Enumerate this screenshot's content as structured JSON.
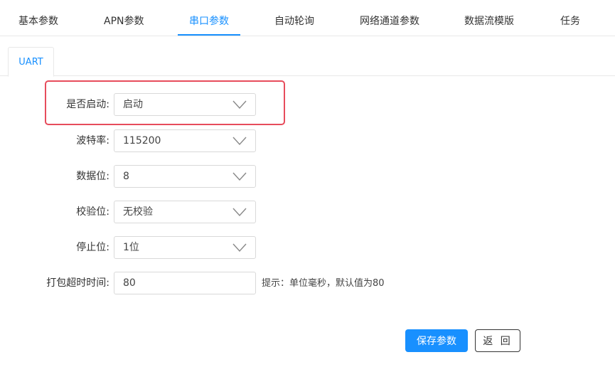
{
  "top_tabs": [
    {
      "label": "基本参数",
      "active": false
    },
    {
      "label": "APN参数",
      "active": false
    },
    {
      "label": "串口参数",
      "active": true
    },
    {
      "label": "自动轮询",
      "active": false
    },
    {
      "label": "网络通道参数",
      "active": false
    },
    {
      "label": "数据流模版",
      "active": false
    },
    {
      "label": "任务",
      "active": false
    }
  ],
  "sub_tabs": [
    {
      "label": "UART",
      "active": true
    }
  ],
  "form": {
    "enabled": {
      "label": "是否启动:",
      "value": "启动"
    },
    "baud_rate": {
      "label": "波特率:",
      "value": "115200"
    },
    "data_bits": {
      "label": "数据位:",
      "value": "8"
    },
    "parity": {
      "label": "校验位:",
      "value": "无校验"
    },
    "stop_bits": {
      "label": "停止位:",
      "value": "1位"
    },
    "pack_timeout": {
      "label": "打包超时时间:",
      "value": "80",
      "hint": "提示：单位毫秒，默认值为80"
    }
  },
  "buttons": {
    "save_label": "保存参数",
    "back_label": "返 回"
  },
  "colors": {
    "accent": "#1890ff",
    "highlight": "#e74c5c",
    "border": "#d9d9d9"
  }
}
